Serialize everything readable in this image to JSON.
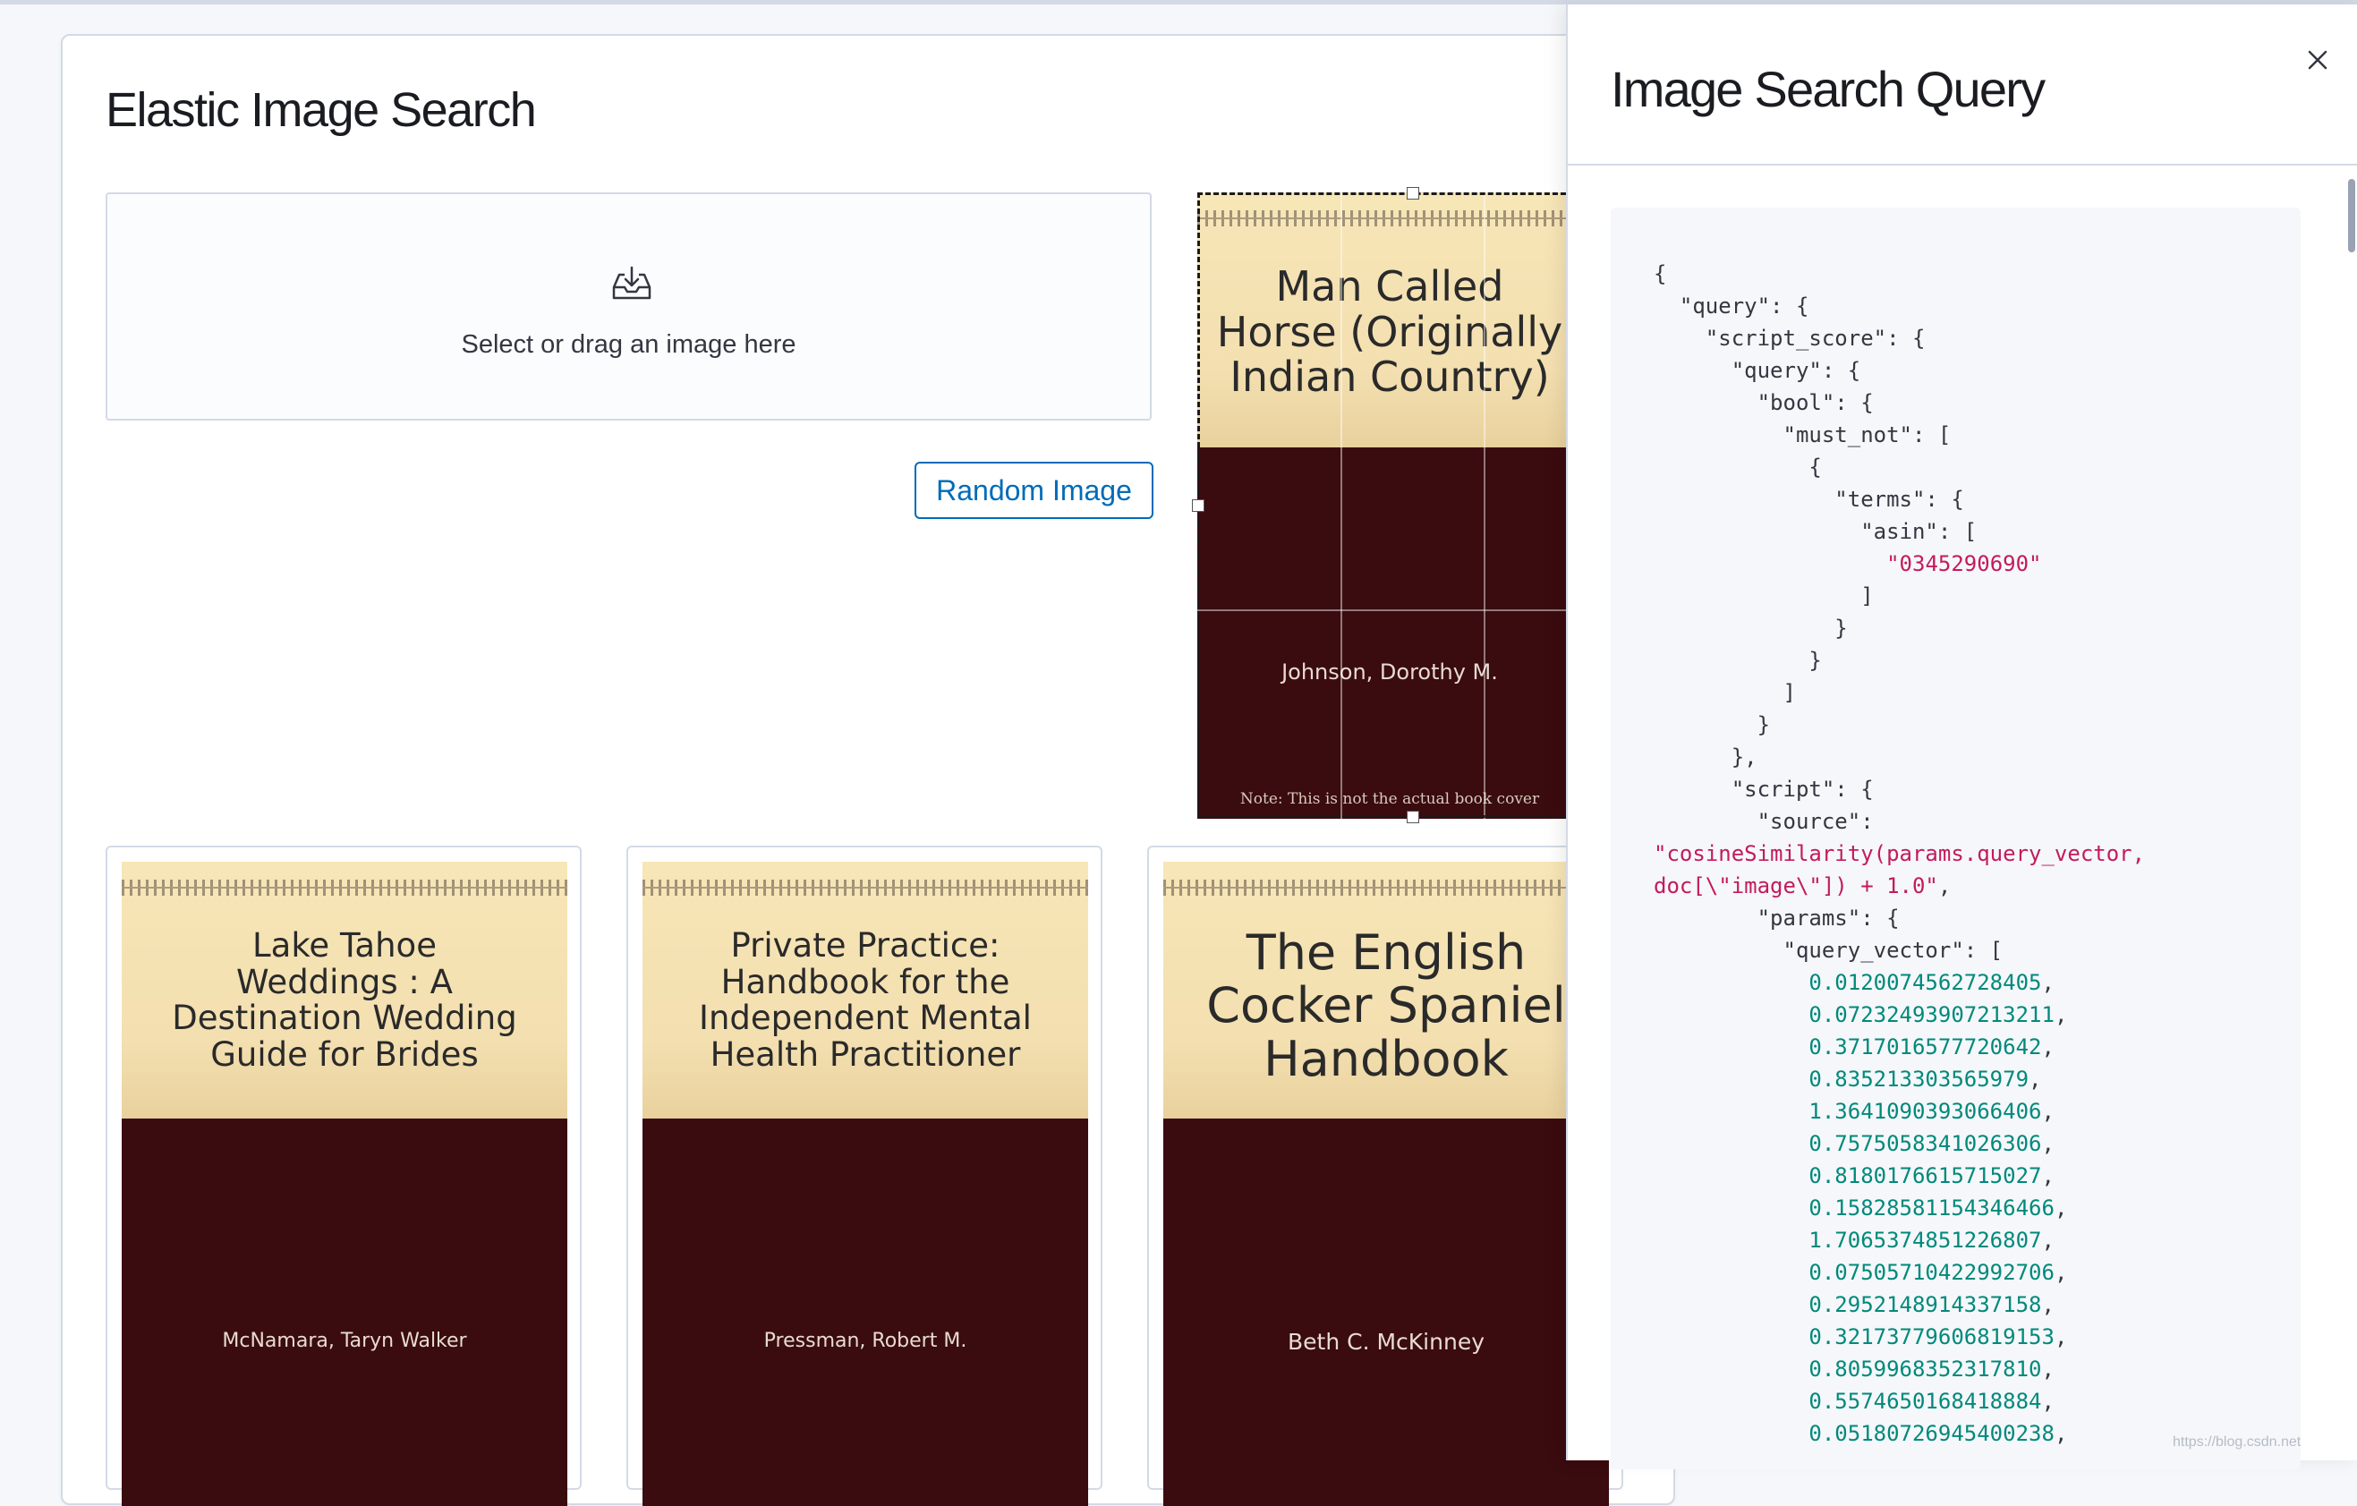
{
  "app": {
    "title": "Elastic Image Search",
    "dropzone_text": "Select or drag an image here",
    "random_button": "Random Image"
  },
  "selected_book": {
    "title_lines": [
      "Man Called",
      "Horse (Originally",
      "Indian Country)"
    ],
    "author": "Johnson, Dorothy M.",
    "note": "Note: This is not the actual book cover"
  },
  "results": [
    {
      "title_lines": [
        "Lake Tahoe",
        "Weddings : A",
        "Destination Wedding",
        "Guide for Brides"
      ],
      "author": "McNamara, Taryn Walker"
    },
    {
      "title_lines": [
        "Private Practice:",
        "Handbook for the",
        "Independent Mental",
        "Health Practitioner"
      ],
      "author": "Pressman, Robert M."
    },
    {
      "title_lines": [
        "The English",
        "Cocker Spaniel",
        "Handbook"
      ],
      "author": "Beth C. McKinney"
    }
  ],
  "flyout": {
    "title": "Image Search Query",
    "code": {
      "line_01": "{",
      "line_02": "  \"query\": {",
      "line_03": "    \"script_score\": {",
      "line_04": "      \"query\": {",
      "line_05": "        \"bool\": {",
      "line_06": "          \"must_not\": [",
      "line_07": "            {",
      "line_08": "              \"terms\": {",
      "line_09": "                \"asin\": [",
      "asin_value": "\"0345290690\"",
      "line_11": "                ]",
      "line_12": "              }",
      "line_13": "            }",
      "line_14": "          ]",
      "line_15": "        }",
      "line_16": "      },",
      "line_17": "      \"script\": {",
      "line_18": "        \"source\":",
      "source_line1": "\"cosineSimilarity(params.query_vector,",
      "source_line2": "doc[\\\"image\\\"]) + 1.0\"",
      "line_21": "        \"params\": {",
      "line_22": "          \"query_vector\": ["
    },
    "query_vector": [
      "0.0120074562728405",
      "0.07232493907213211",
      "0.3717016577720642",
      "0.835213303565979",
      "1.3641090393066406",
      "0.7575058341026306",
      "0.8180176615715027",
      "0.15828581154346466",
      "1.7065374851226807",
      "0.07505710422992706",
      "0.2952148914337158",
      "0.32173779606819153",
      "0.8059968352317810",
      "0.5574650168418884",
      "0.05180726945400238"
    ]
  },
  "colors": {
    "accent": "#006bb8",
    "string": "#c41a5e",
    "number": "#00897b",
    "cover_top": "#f3dfb0",
    "cover_bottom": "#3a0b0f"
  },
  "watermark": "https://blog.csdn.net"
}
